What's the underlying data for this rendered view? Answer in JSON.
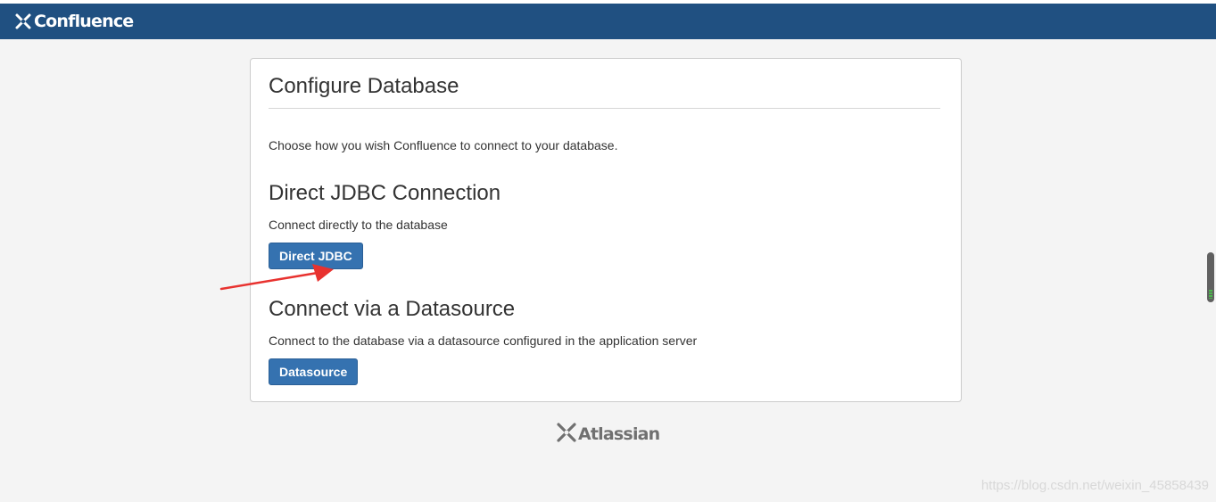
{
  "header": {
    "brand": "Confluence",
    "brand_color": "#205081"
  },
  "card": {
    "title": "Configure Database",
    "intro": "Choose how you wish Confluence to connect to your database.",
    "sections": [
      {
        "heading": "Direct JDBC Connection",
        "description": "Connect directly to the database",
        "button_label": "Direct JDBC"
      },
      {
        "heading": "Connect via a Datasource",
        "description": "Connect to the database via a datasource configured in the application server",
        "button_label": "Datasource"
      }
    ]
  },
  "annotation": {
    "arrow_color": "#e8322f",
    "target": "Direct JDBC"
  },
  "footer": {
    "brand": "Atlassian"
  },
  "watermark": {
    "text": "https://blog.csdn.net/weixin_45858439"
  },
  "colors": {
    "primary_button": "#3572b0",
    "page_background": "#f4f4f4"
  }
}
